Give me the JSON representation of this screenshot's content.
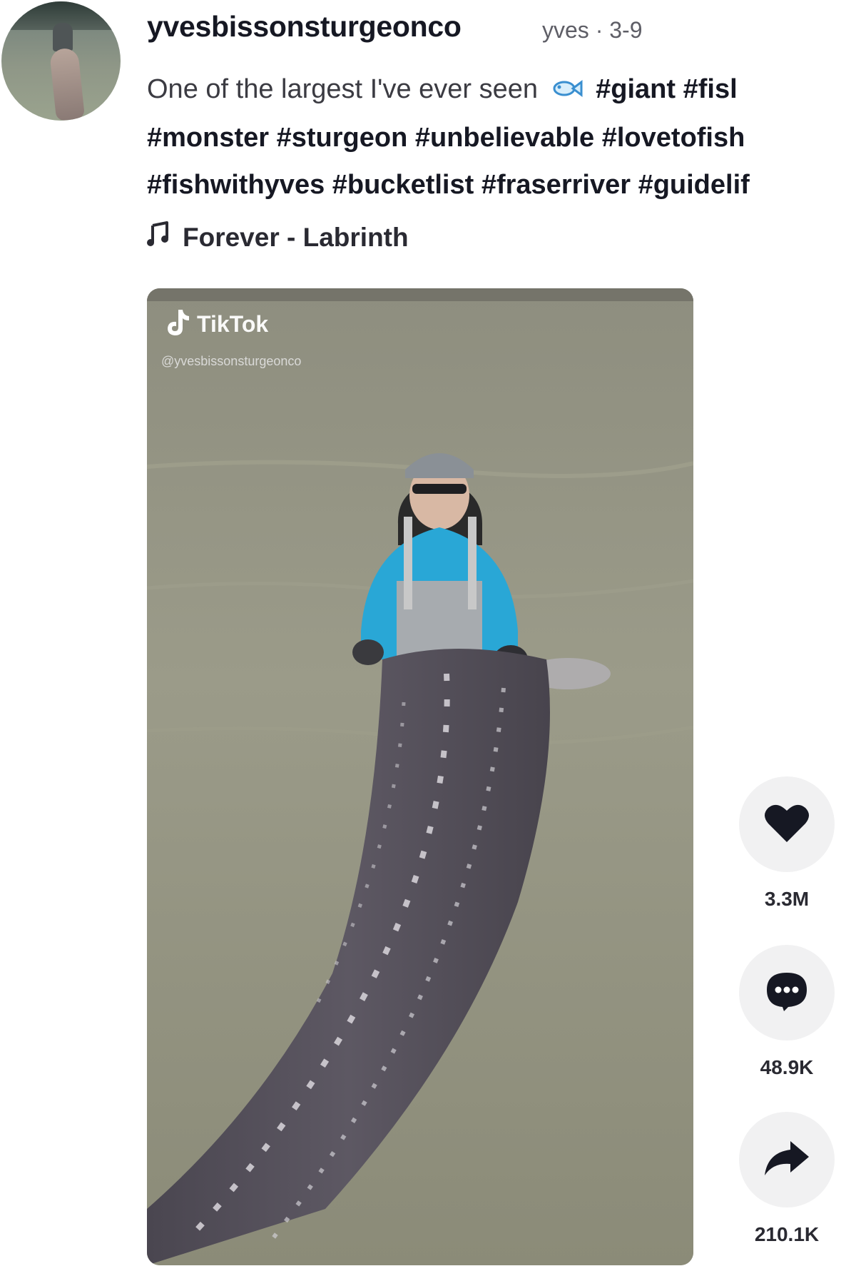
{
  "post": {
    "username": "yvesbissonsturgeonco",
    "meta": "yves · 3-9",
    "caption_text": "One of the largest I've ever seen",
    "caption_line1_tags": "#giant #fisl",
    "caption_line2": "#monster #sturgeon #unbelievable #lovetofish",
    "caption_line3": "#fishwithyves #bucketlist #fraserriver #guidelif"
  },
  "music": {
    "label": "Forever - Labrinth"
  },
  "video": {
    "watermark_brand": "TikTok",
    "watermark_handle": "@yvesbissonsturgeonco"
  },
  "actions": {
    "likes": "3.3M",
    "comments": "48.9K",
    "shares": "210.1K"
  },
  "icons": [
    "heart-icon",
    "comment-icon",
    "share-icon",
    "music-note-icon",
    "fish-emoji-icon",
    "tiktok-logo-icon"
  ],
  "colors": {
    "text_primary": "#161823",
    "text_secondary": "#5e5e66",
    "action_bg": "#f1f1f2"
  }
}
